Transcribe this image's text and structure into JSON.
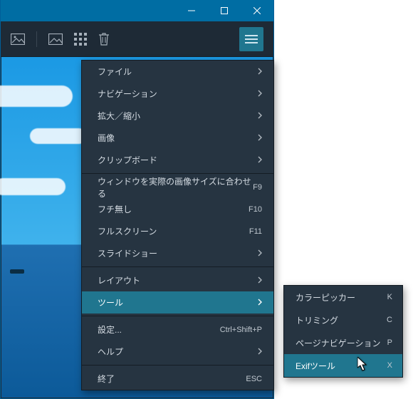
{
  "menu": {
    "items": [
      {
        "label": "ファイル",
        "sub": true
      },
      {
        "label": "ナビゲーション",
        "sub": true
      },
      {
        "label": "拡大／縮小",
        "sub": true
      },
      {
        "label": "画像",
        "sub": true
      },
      {
        "label": "クリップボード",
        "sub": true
      }
    ],
    "group2": [
      {
        "label": "ウィンドウを実際の画像サイズに合わせる",
        "shortcut": "F9"
      },
      {
        "label": "フチ無し",
        "shortcut": "F10"
      },
      {
        "label": "フルスクリーン",
        "shortcut": "F11"
      },
      {
        "label": "スライドショー",
        "sub": true
      }
    ],
    "group3": [
      {
        "label": "レイアウト",
        "sub": true
      },
      {
        "label": "ツール",
        "sub": true,
        "active": true
      }
    ],
    "group4": [
      {
        "label": "設定...",
        "shortcut": "Ctrl+Shift+P"
      },
      {
        "label": "ヘルプ",
        "sub": true
      }
    ],
    "group5": [
      {
        "label": "終了",
        "shortcut": "ESC"
      }
    ]
  },
  "submenu": {
    "items": [
      {
        "label": "カラーピッカー",
        "shortcut": "K"
      },
      {
        "label": "トリミング",
        "shortcut": "C"
      },
      {
        "label": "ページナビゲーション",
        "shortcut": "P"
      },
      {
        "label": "Exifツール",
        "shortcut": "X",
        "active": true
      }
    ]
  }
}
